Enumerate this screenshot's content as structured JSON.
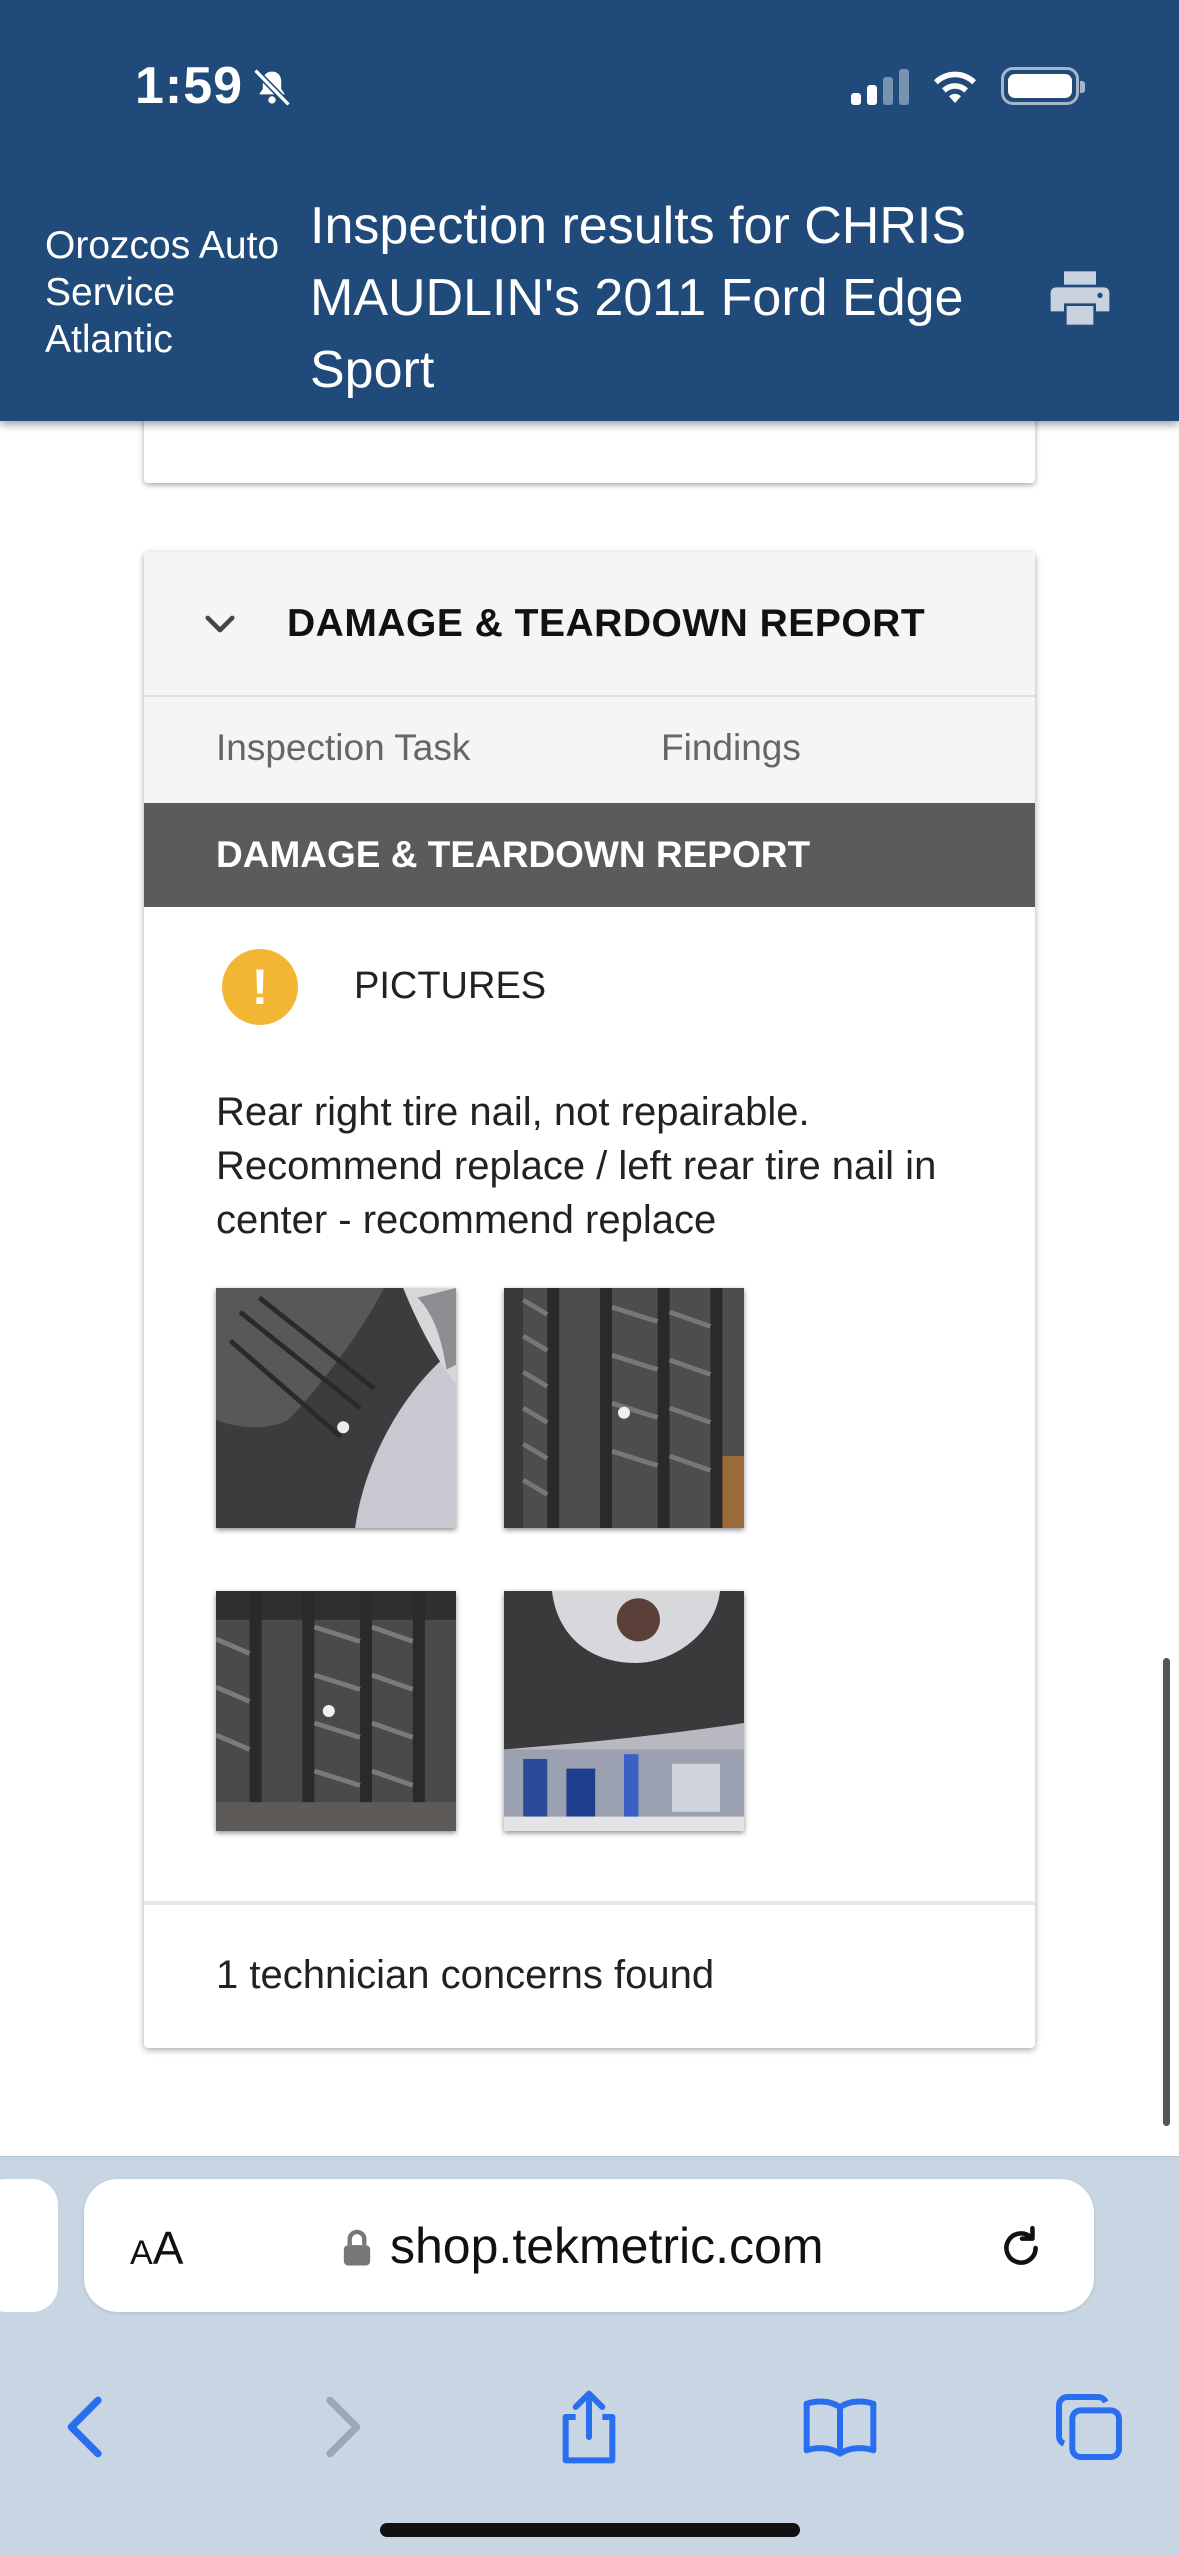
{
  "status_bar": {
    "time": "1:59"
  },
  "header": {
    "shop_name": "Orozcos Auto Service Atlantic",
    "title": "Inspection results for CHRIS MAUDLIN's 2011 Ford Edge Sport"
  },
  "card": {
    "title": "DAMAGE & TEARDOWN REPORT",
    "columns": [
      "Inspection Task",
      "Findings"
    ],
    "section": "DAMAGE & TEARDOWN REPORT",
    "finding": {
      "status_color": "#f2b632",
      "label": "PICTURES",
      "note": "Rear right tire nail, not repairable. Recommend replace / left rear tire nail in center - recommend replace"
    },
    "footer": "1 technician concerns found"
  },
  "browser": {
    "text_size_label": "AA",
    "url": "shop.tekmetric.com"
  },
  "colors": {
    "header_bg": "#1f4a7a",
    "section_bar": "#5b5b5b",
    "warning": "#f2b632"
  },
  "icons": [
    "bell-slash-icon",
    "signal-icon",
    "wifi-icon",
    "battery-icon",
    "print-icon",
    "chevron-down-icon",
    "warning-icon",
    "lock-icon",
    "reload-icon",
    "back-icon",
    "forward-icon",
    "share-icon",
    "bookmarks-icon",
    "tabs-icon"
  ]
}
